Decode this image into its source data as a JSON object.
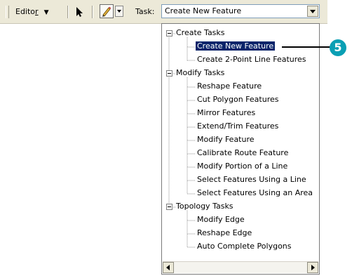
{
  "toolbar": {
    "editor_label": "Editor",
    "editor_accel": "r",
    "editor_prefix": "Edito",
    "task_label": "Task:",
    "task_value": "Create New Feature"
  },
  "dropdown": {
    "groups": [
      {
        "label": "Create Tasks",
        "items": [
          "Create New Feature",
          "Create 2-Point Line Features"
        ]
      },
      {
        "label": "Modify Tasks",
        "items": [
          "Reshape Feature",
          "Cut Polygon Features",
          "Mirror Features",
          "Extend/Trim Features",
          "Modify Feature",
          "Calibrate Route Feature",
          "Modify Portion of a Line",
          "Select Features Using a Line",
          "Select Features Using an Area"
        ]
      },
      {
        "label": "Topology Tasks",
        "items": [
          "Modify Edge",
          "Reshape Edge",
          "Auto Complete Polygons"
        ]
      }
    ],
    "selected": "Create New Feature"
  },
  "callout": {
    "number": "5"
  },
  "colors": {
    "selection": "#0a246a",
    "callout": "#0a9fb4",
    "toolbar": "#ece9d8"
  },
  "icons": [
    "select-arrow-icon",
    "pencil-icon",
    "chevron-down-icon",
    "tree-collapse-icon",
    "scroll-left-icon",
    "scroll-right-icon"
  ]
}
